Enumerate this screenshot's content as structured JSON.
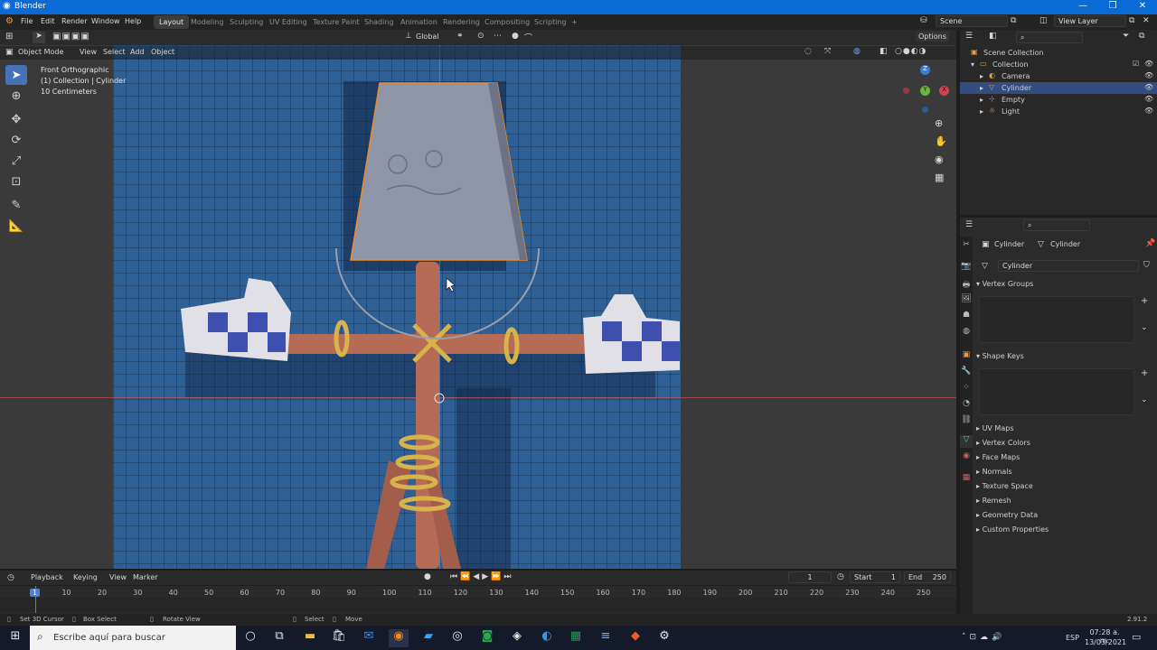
{
  "window": {
    "title": "Blender",
    "controls": [
      "—",
      "❐",
      "✕"
    ]
  },
  "menu": [
    "File",
    "Edit",
    "Render",
    "Window",
    "Help"
  ],
  "workspaces": [
    "Layout",
    "Modeling",
    "Sculpting",
    "UV Editing",
    "Texture Paint",
    "Shading",
    "Animation",
    "Rendering",
    "Compositing",
    "Scripting",
    "+"
  ],
  "active_workspace": "Layout",
  "scene": "Scene",
  "view_layer": "View Layer",
  "header": {
    "orientation": "Global",
    "options": "Options"
  },
  "viewport_menu": {
    "mode": "Object Mode",
    "items": [
      "View",
      "Select",
      "Add",
      "Object"
    ]
  },
  "overlay_text": {
    "view": "Front Orthographic",
    "collection": "(1) Collection | Cylinder",
    "scale": "10 Centimeters"
  },
  "gizmo": {
    "z": "Z",
    "y": "Y",
    "x": "X"
  },
  "outliner": {
    "rows": [
      {
        "label": "Scene Collection",
        "indent": 0,
        "icon": "▣",
        "selected": false
      },
      {
        "label": "Collection",
        "indent": 1,
        "icon": "▭",
        "selected": false
      },
      {
        "label": "Camera",
        "indent": 2,
        "icon": "◐",
        "selected": false
      },
      {
        "label": "Cylinder",
        "indent": 2,
        "icon": "▽",
        "selected": true
      },
      {
        "label": "Empty",
        "indent": 2,
        "icon": "⊹",
        "selected": false
      },
      {
        "label": "Light",
        "indent": 2,
        "icon": "☼",
        "selected": false
      }
    ]
  },
  "properties": {
    "breadcrumb_object": "Cylinder",
    "breadcrumb_data": "Cylinder",
    "mesh_name": "Cylinder",
    "panels": [
      "Vertex Groups",
      "Shape Keys",
      "UV Maps",
      "Vertex Colors",
      "Face Maps",
      "Normals",
      "Texture Space",
      "Remesh",
      "Geometry Data",
      "Custom Properties"
    ]
  },
  "timeline": {
    "menus": [
      "Playback",
      "Keying",
      "View",
      "Marker"
    ],
    "current_frame": "1",
    "start_label": "Start",
    "start": "1",
    "end_label": "End",
    "end": "250",
    "ticks": [
      "1",
      "10",
      "20",
      "30",
      "40",
      "50",
      "60",
      "70",
      "80",
      "90",
      "100",
      "110",
      "120",
      "130",
      "140",
      "150",
      "160",
      "170",
      "180",
      "190",
      "200",
      "210",
      "220",
      "230",
      "240",
      "250"
    ]
  },
  "status": {
    "items": [
      "Set 3D Cursor",
      "Box Select",
      "Rotate View",
      "Select",
      "Move"
    ],
    "version": "2.91.2"
  },
  "taskbar": {
    "search_placeholder": "Escribe aquí para buscar",
    "lang": "ESP",
    "time": "07:28 a. m.",
    "date": "13/03/2021"
  }
}
